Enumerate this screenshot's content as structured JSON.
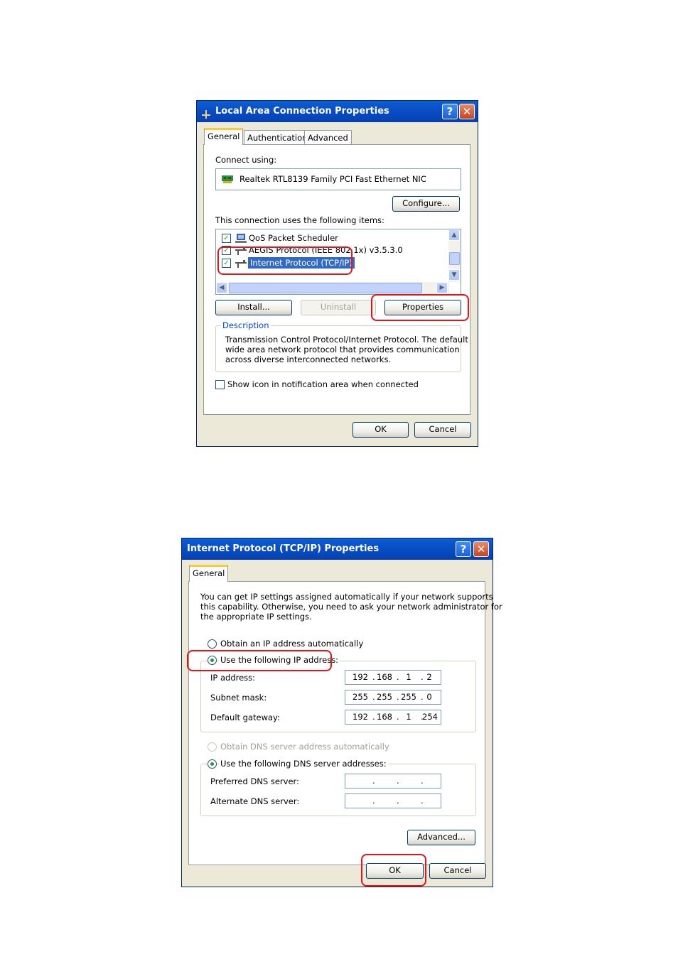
{
  "dialog1": {
    "title": "Local Area Connection Properties",
    "tabs": [
      "General",
      "Authentication",
      "Advanced"
    ],
    "connect_using_label": "Connect using:",
    "adapter": "Realtek RTL8139 Family PCI Fast Ethernet NIC",
    "configure_label": "Configure...",
    "items_label": "This connection uses the following items:",
    "items": [
      {
        "label": "QoS Packet Scheduler",
        "checked": true
      },
      {
        "label": "AEGIS Protocol (IEEE 802.1x) v3.5.3.0",
        "checked": true
      },
      {
        "label": "Internet Protocol (TCP/IP)",
        "checked": true,
        "selected": true
      }
    ],
    "install_label": "Install...",
    "uninstall_label": "Uninstall",
    "properties_label": "Properties",
    "description_title": "Description",
    "description_text": [
      "Transmission Control Protocol/Internet Protocol. The default",
      "wide area network protocol that provides communication",
      "across diverse interconnected networks."
    ],
    "show_icon_label": "Show icon in notification area when connected",
    "show_icon_checked": false,
    "ok_label": "OK",
    "cancel_label": "Cancel"
  },
  "dialog2": {
    "title": "Internet Protocol (TCP/IP) Properties",
    "tab": "General",
    "intro": [
      "You can get IP settings assigned automatically if your network supports",
      "this capability. Otherwise, you need to ask your network administrator for",
      "the appropriate IP settings."
    ],
    "obtain_ip_label": "Obtain an IP address automatically",
    "use_ip_label": "Use the following IP address:",
    "ip_label": "IP address:",
    "ip_octets": [
      "192",
      "168",
      "1",
      "2"
    ],
    "subnet_label": "Subnet mask:",
    "subnet_octets": [
      "255",
      "255",
      "255",
      "0"
    ],
    "gateway_label": "Default gateway:",
    "gateway_octets": [
      "192",
      "168",
      "1",
      "254"
    ],
    "obtain_dns_label": "Obtain DNS server address automatically",
    "use_dns_label": "Use the following DNS server addresses:",
    "preferred_dns_label": "Preferred DNS server:",
    "alternate_dns_label": "Alternate DNS server:",
    "advanced_label": "Advanced...",
    "ok_label": "OK",
    "cancel_label": "Cancel"
  },
  "colors": {
    "highlight": "#e5141b",
    "titlebar": "#0b4fc4",
    "selection": "#316ac5"
  },
  "icons": [
    "connection-icon",
    "help-icon",
    "close-icon",
    "nic-icon",
    "qos-icon",
    "protocol-icon"
  ]
}
